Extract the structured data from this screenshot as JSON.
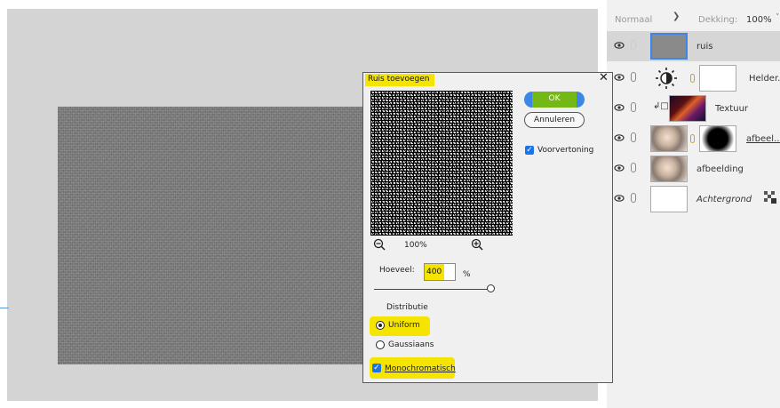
{
  "layers_panel": {
    "blend_mode": "Normaal",
    "opacity_label": "Dekking:",
    "opacity_value": "100%",
    "layers": [
      {
        "name": "ruis",
        "selected": true
      },
      {
        "name": "Helder..."
      },
      {
        "name": "Textuur"
      },
      {
        "name": "afbeel..."
      },
      {
        "name": "afbeelding"
      },
      {
        "name": "Achtergrond"
      }
    ]
  },
  "dialog": {
    "title": "Ruis toevoegen",
    "close_glyph": "✕",
    "ok_label": "OK",
    "cancel_label": "Annuleren",
    "preview_label": "Voorvertoning",
    "preview_checked": true,
    "zoom_value": "100%",
    "amount_label": "Hoeveel:",
    "amount_value": "400",
    "amount_unit": "%",
    "distribution_label": "Distributie",
    "uniform_label": "Uniform",
    "gaussian_label": "Gaussiaans",
    "distribution_selected": "Uniform",
    "monochromatic_label": "Monochromatisch",
    "monochromatic_checked": true
  },
  "colors": {
    "highlight": "#f5e400",
    "ok_button": "#3b86e6",
    "ok_highlight": "#74b816",
    "checkbox": "#1a73e8",
    "workspace": "#d4d4d4",
    "canvas_noise": "#7e7e7e"
  },
  "icons": [
    "eye-icon",
    "chain-link-icon",
    "zoom-in-icon",
    "zoom-out-icon",
    "close-icon",
    "check-icon",
    "brightness-icon",
    "transparency-lock-icon"
  ]
}
